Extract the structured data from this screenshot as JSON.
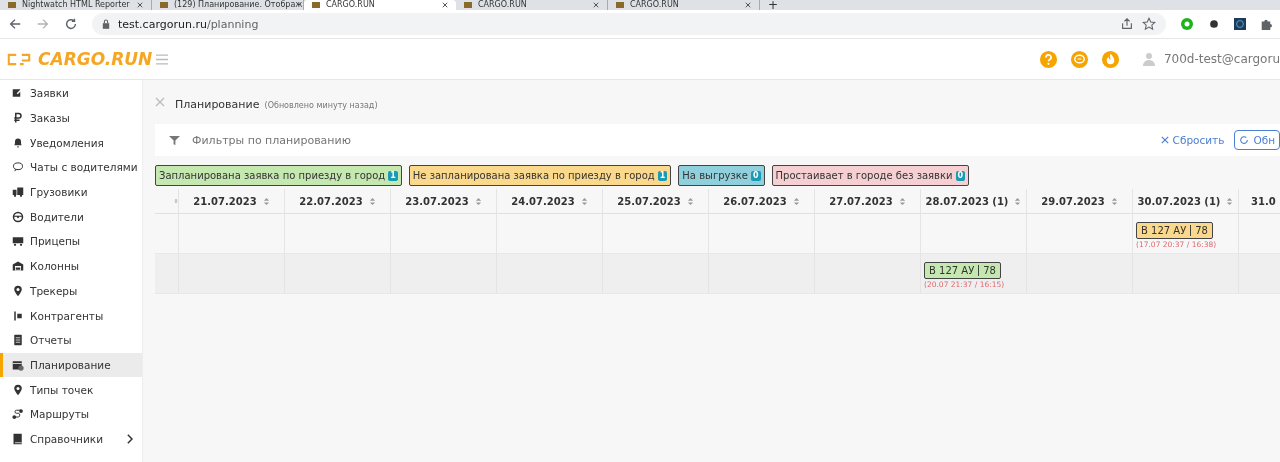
{
  "browser": {
    "tabs": [
      {
        "title": "Nightwatch HTML Reporter",
        "selected": false
      },
      {
        "title": "(129) Планирование. Отображ",
        "selected": false
      },
      {
        "title": "CARGO.RUN",
        "selected": true
      },
      {
        "title": "CARGO.RUN",
        "selected": false
      },
      {
        "title": "CARGO.RUN",
        "selected": false
      }
    ],
    "new_tab": "+",
    "url_host": "test.cargorun.ru",
    "url_path": "/planning"
  },
  "header": {
    "logo": "CARGO.RUN",
    "user": "700d-test@cargoru"
  },
  "sidebar": {
    "items": [
      {
        "label": "Заявки",
        "selected": false,
        "expandable": false
      },
      {
        "label": "Заказы",
        "selected": false,
        "expandable": false
      },
      {
        "label": "Уведомления",
        "selected": false,
        "expandable": false
      },
      {
        "label": "Чаты с водителями",
        "selected": false,
        "expandable": false
      },
      {
        "label": "Грузовики",
        "selected": false,
        "expandable": false
      },
      {
        "label": "Водители",
        "selected": false,
        "expandable": false
      },
      {
        "label": "Прицепы",
        "selected": false,
        "expandable": false
      },
      {
        "label": "Колонны",
        "selected": false,
        "expandable": false
      },
      {
        "label": "Трекеры",
        "selected": false,
        "expandable": false
      },
      {
        "label": "Контрагенты",
        "selected": false,
        "expandable": false
      },
      {
        "label": "Отчеты",
        "selected": false,
        "expandable": false
      },
      {
        "label": "Планирование",
        "selected": true,
        "expandable": false
      },
      {
        "label": "Типы точек",
        "selected": false,
        "expandable": false
      },
      {
        "label": "Маршруты",
        "selected": false,
        "expandable": false
      },
      {
        "label": "Справочники",
        "selected": false,
        "expandable": true
      }
    ]
  },
  "page": {
    "title": "Планирование",
    "subtitle": "(Обновлено минуту назад)",
    "filter": {
      "placeholder": "Фильтры по планированию",
      "reset": "Сбросить",
      "refresh": "Обн"
    },
    "legend": [
      {
        "label": "Запланирована заявка по приезду в город",
        "count": "1",
        "color": "#c5e8b0"
      },
      {
        "label": "Не запланирована заявка по приезду в город",
        "count": "1",
        "color": "#fbd98c"
      },
      {
        "label": "На выгрузке",
        "count": "0",
        "color": "#8fd0dc"
      },
      {
        "label": "Простаивает в городе без заявки",
        "count": "0",
        "color": "#f5cfd2"
      }
    ],
    "table": {
      "columns": [
        "21.07.2023",
        "22.07.2023",
        "23.07.2023",
        "24.07.2023",
        "25.07.2023",
        "26.07.2023",
        "27.07.2023",
        "28.07.2023 (1)",
        "29.07.2023",
        "30.07.2023 (1)",
        "31.0"
      ],
      "rows": [
        {
          "cells": [
            {},
            {},
            {},
            {},
            {},
            {},
            {},
            {},
            {},
            {
              "trip": {
                "plate": "В 127 АУ",
                "region": "78",
                "times": "(17.07 20:37 / 16:38)",
                "color": "#fbd98c"
              }
            },
            {}
          ]
        },
        {
          "cells": [
            {},
            {},
            {},
            {},
            {},
            {},
            {},
            {
              "trip": {
                "plate": "В 127 АУ",
                "region": "78",
                "times": "(20.07 21:37 / 16:15)",
                "color": "#c5e8b0"
              }
            },
            {},
            {},
            {}
          ]
        }
      ]
    }
  }
}
